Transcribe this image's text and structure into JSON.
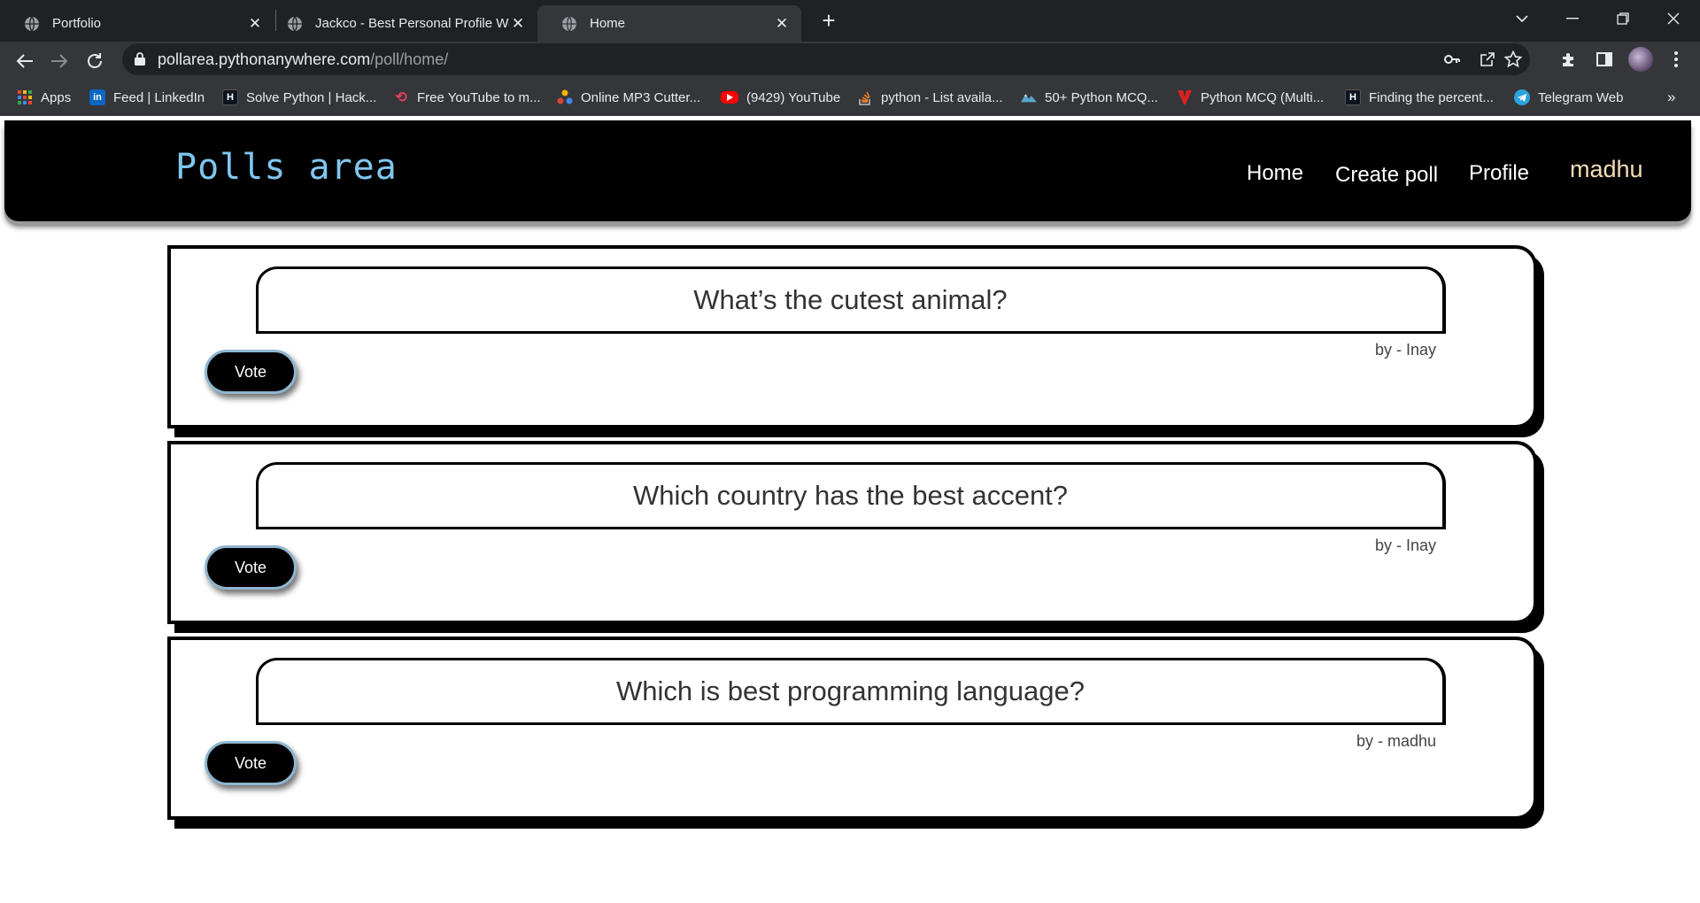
{
  "browser": {
    "tabs": [
      {
        "title": "Portfolio",
        "active": false
      },
      {
        "title": "Jackco - Best Personal Profile We",
        "active": false
      },
      {
        "title": "Home",
        "active": true
      }
    ],
    "url": {
      "host": "pollarea.pythonanywhere.com",
      "path": "/poll/home/"
    },
    "bookmarks": [
      {
        "label": "Apps",
        "icon": "apps-grid-icon"
      },
      {
        "label": "Feed | LinkedIn",
        "icon": "linkedin-icon"
      },
      {
        "label": "Solve Python | Hack...",
        "icon": "hackerrank-icon"
      },
      {
        "label": "Free YouTube to m...",
        "icon": "converter-icon"
      },
      {
        "label": "Online MP3 Cutter...",
        "icon": "mp3-cutter-icon"
      },
      {
        "label": "(9429) YouTube",
        "icon": "youtube-icon"
      },
      {
        "label": "python - List availa...",
        "icon": "stackoverflow-icon"
      },
      {
        "label": "50+ Python MCQ...",
        "icon": "mountain-icon"
      },
      {
        "label": "Python MCQ (Multi...",
        "icon": "v-logo-icon"
      },
      {
        "label": "Finding the percent...",
        "icon": "hackerrank-icon"
      },
      {
        "label": "Telegram Web",
        "icon": "telegram-icon"
      }
    ],
    "overflow": "»"
  },
  "site": {
    "brand": "Polls area",
    "nav": {
      "home": "Home",
      "create": "Create poll",
      "profile": "Profile",
      "user": "madhu"
    }
  },
  "polls": [
    {
      "question": "What’s the cutest animal?",
      "author": "by - Inay",
      "vote_label": "Vote"
    },
    {
      "question": "Which country has the best accent?",
      "author": "by - Inay",
      "vote_label": "Vote"
    },
    {
      "question": "Which is best programming language?",
      "author": "by - madhu",
      "vote_label": "Vote"
    }
  ],
  "colors": {
    "brand": "#7fc6f0",
    "user": "#f7ddb8",
    "vote_border": "#8fb6d0"
  }
}
